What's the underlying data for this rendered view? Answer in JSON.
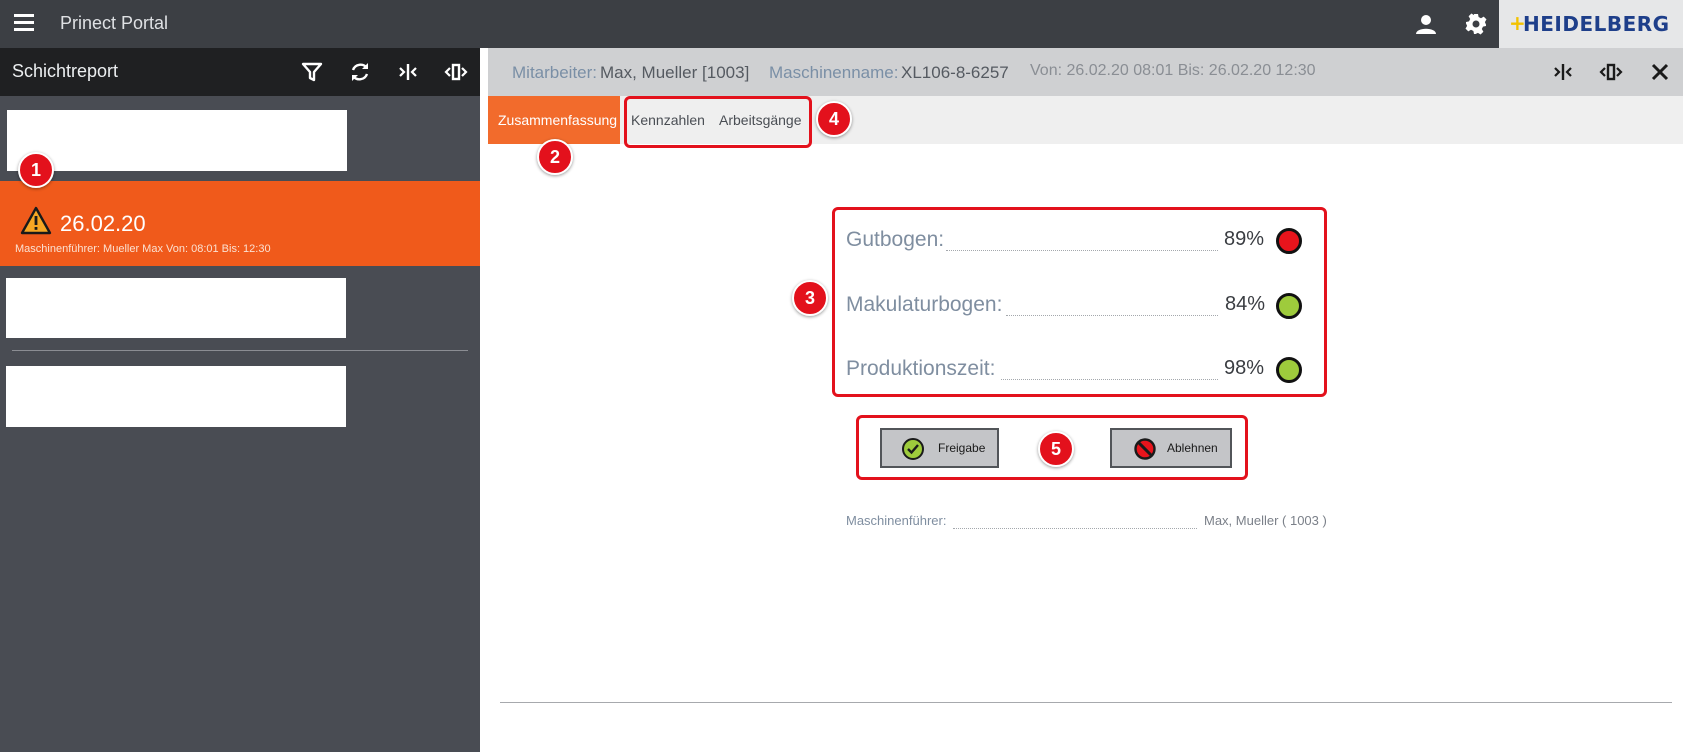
{
  "app": {
    "title": "Prinect Portal",
    "logo": "HEIDELBERG"
  },
  "sidebar": {
    "title": "Schichtreport",
    "tools": [
      "filter-icon",
      "refresh-icon",
      "collapse-icon",
      "expand-icon"
    ],
    "selected_item": {
      "date": "26.02.20",
      "subtitle": "Maschinenführer: Mueller Max Von: 08:01 Bis: 12:30"
    }
  },
  "header": {
    "employee_label": "Mitarbeiter:",
    "employee_value": "Max, Mueller [1003]",
    "machine_label": "Maschinenname:",
    "machine_value": "XL106-8-6257",
    "period": "Von: 26.02.20 08:01 Bis: 26.02.20 12:30"
  },
  "tabs": [
    {
      "label": "Zusammenfassung",
      "active": true
    },
    {
      "label": "Kennzahlen",
      "active": false
    },
    {
      "label": "Arbeitsgänge",
      "active": false
    }
  ],
  "metrics": [
    {
      "label": "Gutbogen:",
      "value": "89%",
      "status_color": "#e8141c"
    },
    {
      "label": "Makulaturbogen:",
      "value": "84%",
      "status_color": "#9ecb3c"
    },
    {
      "label": "Produktionszeit:",
      "value": "98%",
      "status_color": "#9ecb3c"
    }
  ],
  "actions": {
    "approve_label": "Freigabe",
    "reject_label": "Ablehnen"
  },
  "operator": {
    "label": "Maschinenführer:",
    "value": "Max, Mueller ( 1003 )"
  },
  "callouts": [
    "1",
    "2",
    "3",
    "4",
    "5"
  ],
  "colors": {
    "accent": "#f05a1b",
    "callout": "#e3111c",
    "ok": "#9ecb3c",
    "bad": "#e8141c"
  }
}
